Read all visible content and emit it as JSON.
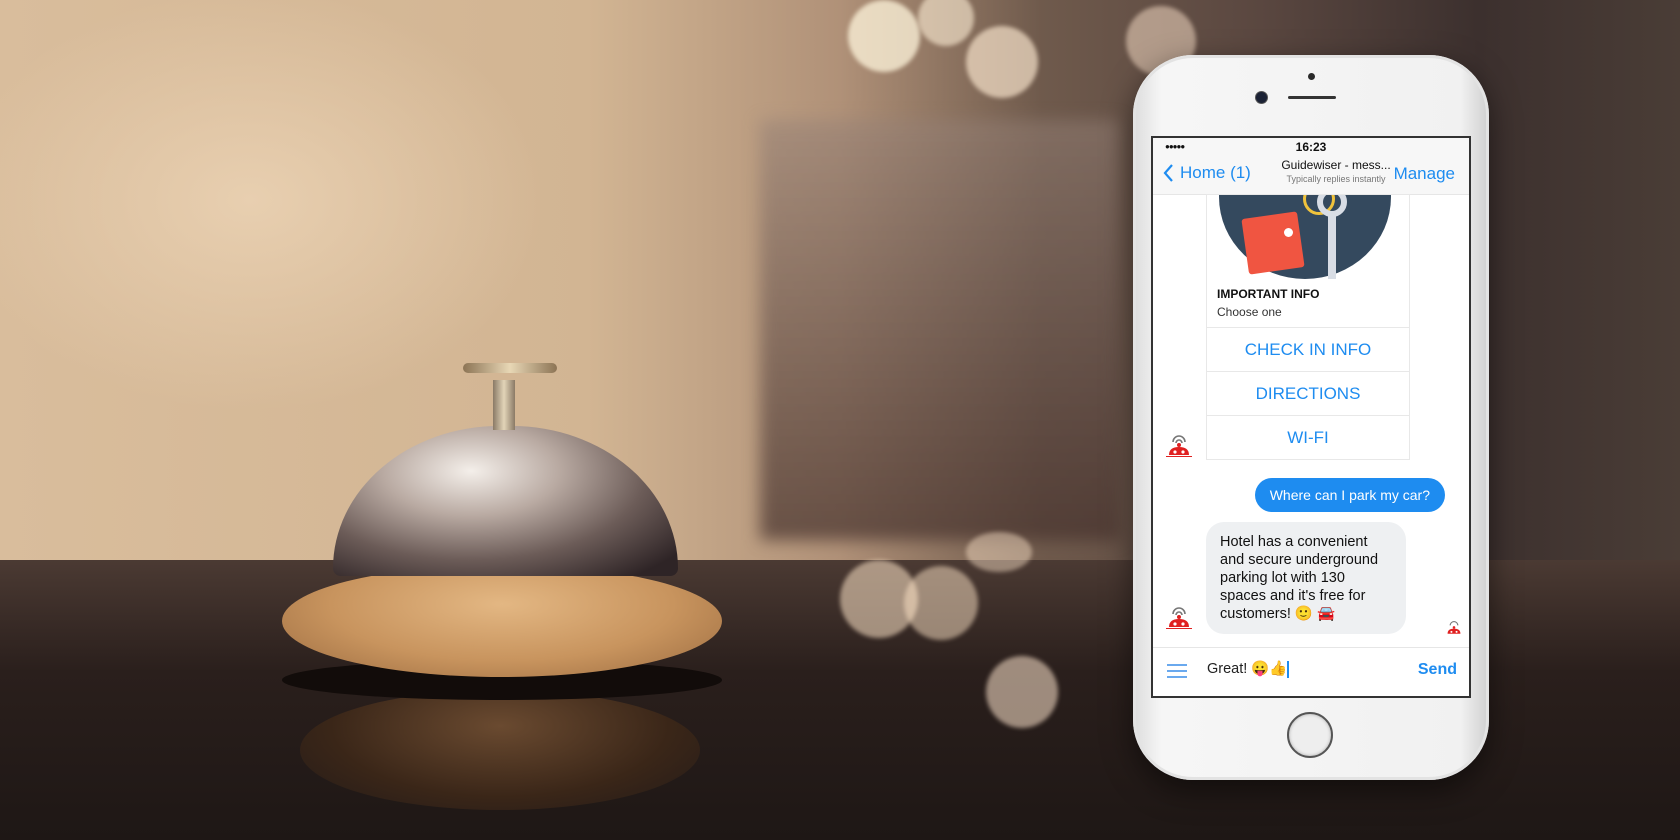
{
  "scene": {
    "description": "Hotel reception bell next to smartphone showing messenger chatbot",
    "colors": {
      "accent": "#1e8cf0",
      "bot_red": "#e02020",
      "card_dark": "#34495e",
      "tag_red": "#f05541"
    }
  },
  "phone": {
    "statusbar": {
      "signal": "●●●●●",
      "time": "16:23"
    },
    "navbar": {
      "back_label": "Home (1)",
      "back_icon": "chevron-left-icon",
      "title": "Guidewiser - mess...",
      "subtitle": "Typically replies instantly",
      "manage_label": "Manage"
    },
    "card": {
      "image_icon": "key-with-tag-icon",
      "title": "IMPORTANT INFO",
      "subtitle": "Choose one",
      "buttons": [
        {
          "label": "CHECK IN INFO"
        },
        {
          "label": "DIRECTIONS"
        },
        {
          "label": "WI-FI"
        }
      ]
    },
    "messages": [
      {
        "from": "user",
        "text": "Where can I park my car?"
      },
      {
        "from": "bot",
        "text": "Hotel has a convenient and secure underground parking lot with 130 spaces and it's free for customers! 🙂 🚘"
      }
    ],
    "composer": {
      "menu_icon": "hamburger-icon",
      "value": "Great! 😛👍",
      "send_label": "Send"
    }
  }
}
